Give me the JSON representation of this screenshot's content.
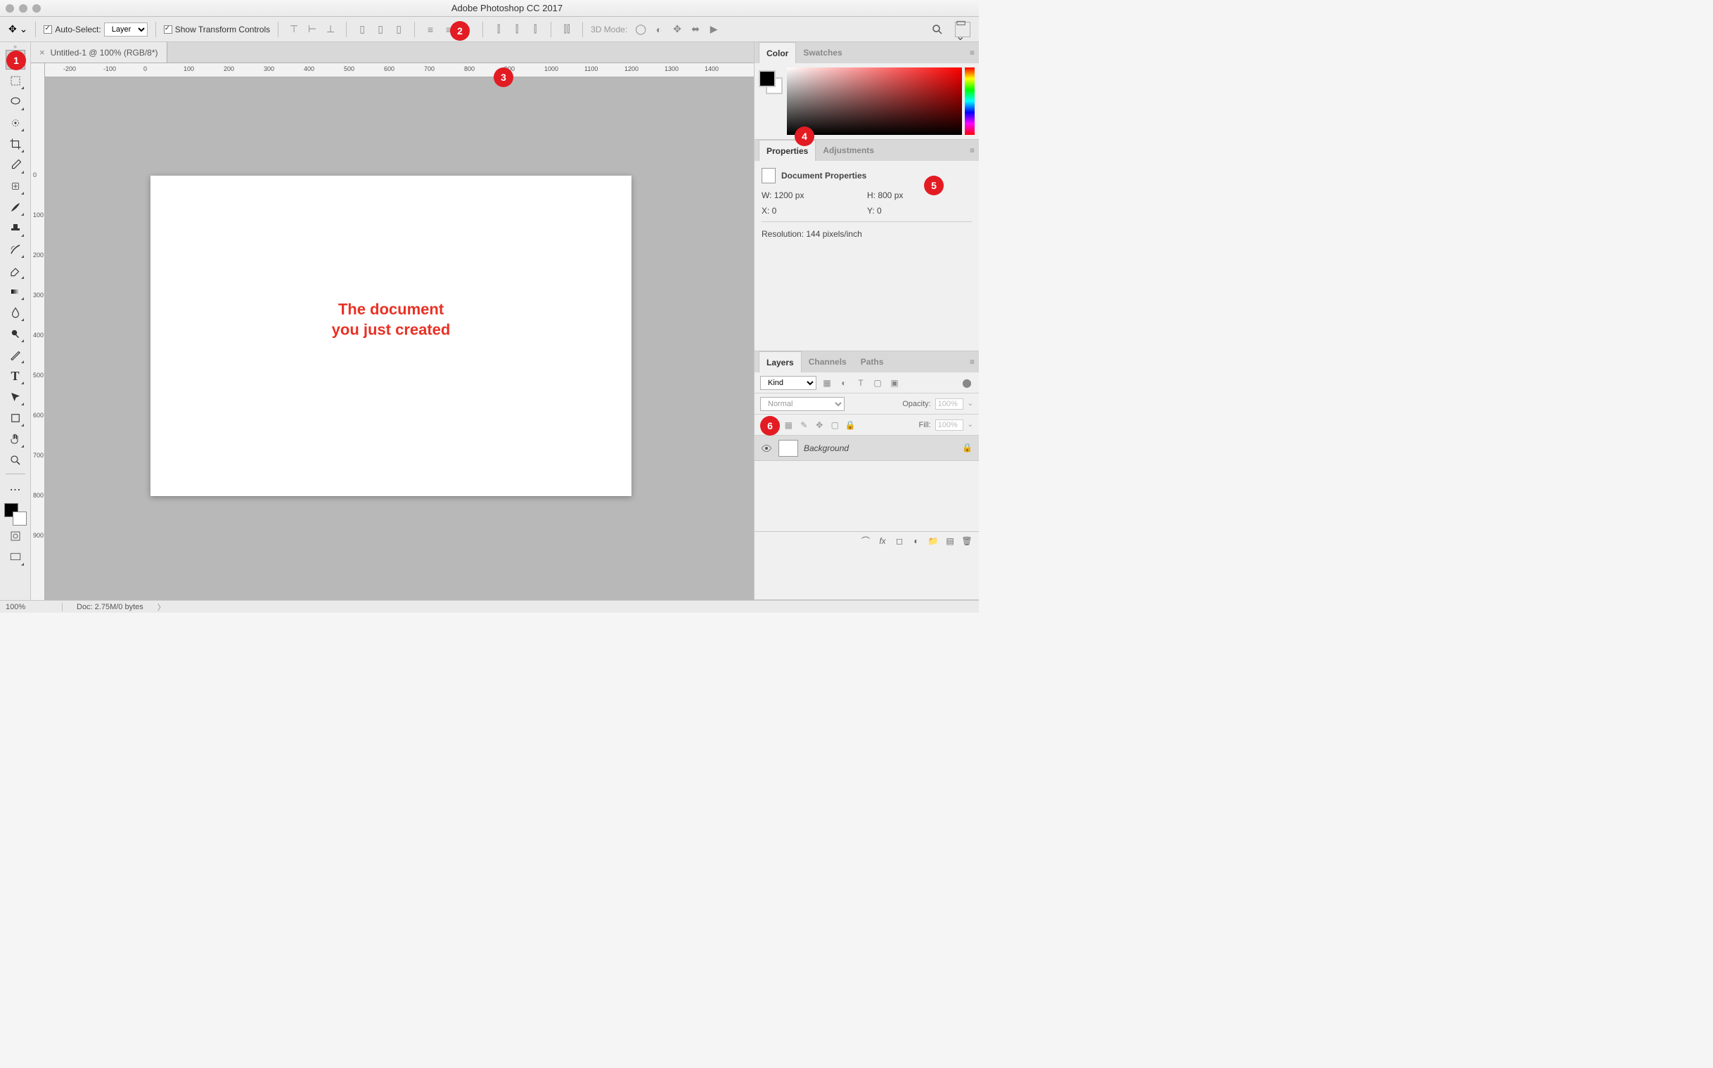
{
  "titlebar": {
    "title": "Adobe Photoshop CC 2017"
  },
  "optionsBar": {
    "autoSelectLabel": "Auto-Select:",
    "layerSelect": "Layer",
    "showTransform": "Show Transform Controls",
    "threeDMode": "3D Mode:"
  },
  "docTab": {
    "title": "Untitled-1 @ 100% (RGB/8*)"
  },
  "rulerH": [
    0,
    100,
    200,
    300,
    400,
    500,
    600,
    700,
    800,
    900,
    1000,
    1100,
    1200,
    1300,
    1400
  ],
  "rulerV": [
    0,
    100,
    200,
    300,
    400,
    500,
    600,
    700,
    800,
    900
  ],
  "canvas": {
    "labelLine1": "The document",
    "labelLine2": "you just created"
  },
  "colorPanel": {
    "tab1": "Color",
    "tab2": "Swatches"
  },
  "propsPanel": {
    "tab1": "Properties",
    "tab2": "Adjustments",
    "header": "Document Properties",
    "w": "W: 1200 px",
    "h": "H: 800 px",
    "x": "X: 0",
    "y": "Y: 0",
    "res": "Resolution: 144 pixels/inch"
  },
  "layersPanel": {
    "tab1": "Layers",
    "tab2": "Channels",
    "tab3": "Paths",
    "filterKind": "Kind",
    "blendMode": "Normal",
    "opacityLabel": "Opacity:",
    "opacityVal": "100%",
    "lockLabel": "Lock:",
    "fillLabel": "Fill:",
    "fillVal": "100%",
    "bgLayerName": "Background"
  },
  "statusBar": {
    "zoom": "100%",
    "docInfo": "Doc: 2.75M/0 bytes"
  },
  "annotations": {
    "a1": "1",
    "a2": "2",
    "a3": "3",
    "a4": "4",
    "a5": "5",
    "a6": "6"
  }
}
